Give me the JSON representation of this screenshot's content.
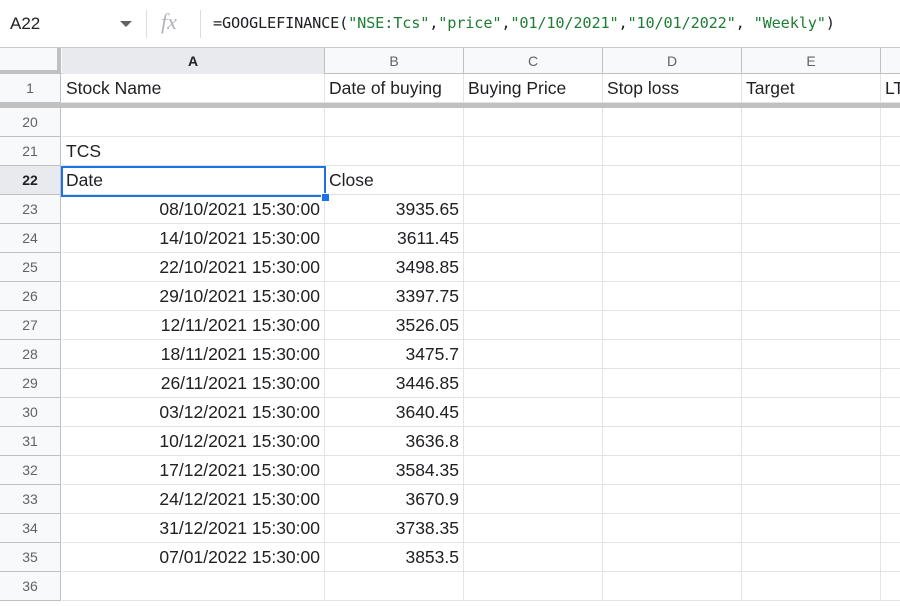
{
  "name_box": {
    "value": "A22"
  },
  "formula_bar": {
    "fn": "=GOOGLEFINANCE(",
    "arg1": "\"NSE:Tcs\"",
    "arg2": "\"price\"",
    "arg3": "\"01/10/2021\"",
    "arg4": "\"10/01/2022\"",
    "arg5": " \"Weekly\"",
    "close": ")"
  },
  "columns": [
    "A",
    "B",
    "C",
    "D",
    "E"
  ],
  "frozen_row": {
    "number": "1",
    "cells": [
      "Stock Name",
      "Date of buying",
      "Buying Price",
      "Stop loss",
      "Target",
      "LT"
    ]
  },
  "rows": [
    {
      "number": "20",
      "a": "",
      "b": ""
    },
    {
      "number": "21",
      "a": "TCS",
      "b": ""
    },
    {
      "number": "22",
      "a": "Date",
      "b": "Close"
    },
    {
      "number": "23",
      "a": "08/10/2021 15:30:00",
      "b": "3935.65"
    },
    {
      "number": "24",
      "a": "14/10/2021 15:30:00",
      "b": "3611.45"
    },
    {
      "number": "25",
      "a": "22/10/2021 15:30:00",
      "b": "3498.85"
    },
    {
      "number": "26",
      "a": "29/10/2021 15:30:00",
      "b": "3397.75"
    },
    {
      "number": "27",
      "a": "12/11/2021 15:30:00",
      "b": "3526.05"
    },
    {
      "number": "28",
      "a": "18/11/2021 15:30:00",
      "b": "3475.7"
    },
    {
      "number": "29",
      "a": "26/11/2021 15:30:00",
      "b": "3446.85"
    },
    {
      "number": "30",
      "a": "03/12/2021 15:30:00",
      "b": "3640.45"
    },
    {
      "number": "31",
      "a": "10/12/2021 15:30:00",
      "b": "3636.8"
    },
    {
      "number": "32",
      "a": "17/12/2021 15:30:00",
      "b": "3584.35"
    },
    {
      "number": "33",
      "a": "24/12/2021 15:30:00",
      "b": "3670.9"
    },
    {
      "number": "34",
      "a": "31/12/2021 15:30:00",
      "b": "3738.35"
    },
    {
      "number": "35",
      "a": "07/01/2022 15:30:00",
      "b": "3853.5"
    },
    {
      "number": "36",
      "a": "",
      "b": ""
    }
  ],
  "colors": {
    "selection": "#1a73e8",
    "string_literal": "#1e7e34",
    "header_bg": "#f8f9fa"
  },
  "icons": {
    "dropdown": "chevron-down-icon",
    "formula": "fx-icon"
  }
}
